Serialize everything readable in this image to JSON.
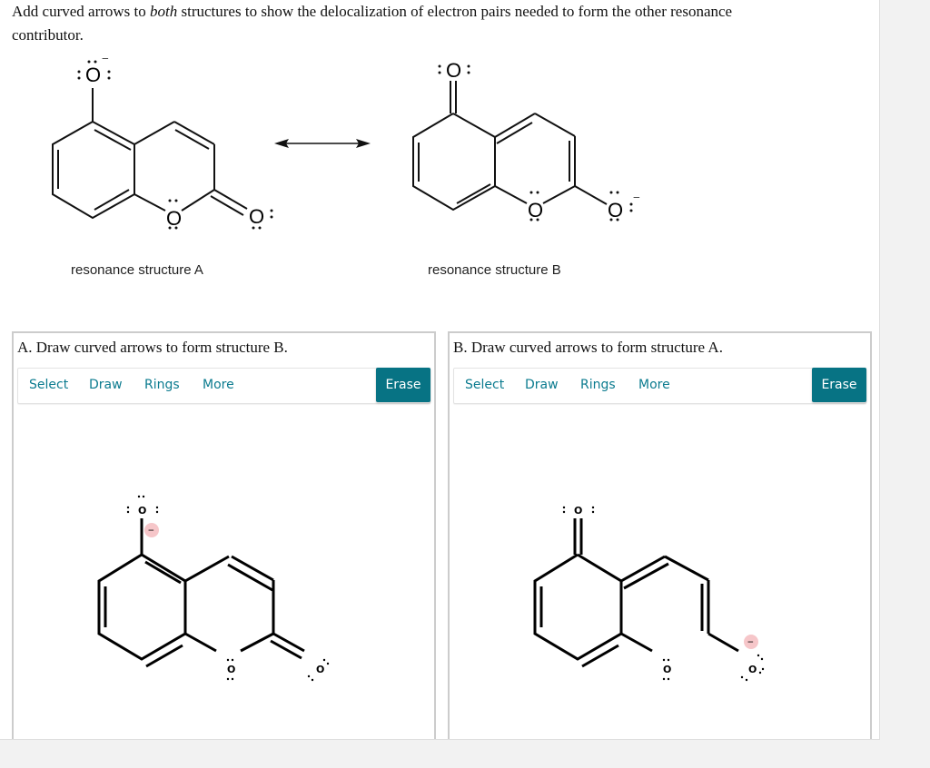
{
  "prompt": {
    "part1": "Add curved arrows to ",
    "emphasis": "both",
    "part2": " structures to show the delocalization of electron pairs needed to form the other resonance contributor."
  },
  "structures": {
    "a_caption": "resonance structure A",
    "b_caption": "resonance structure B",
    "atom_label": "O",
    "charge": "−",
    "resonance_arrow": "double-headed-arrow"
  },
  "panels": [
    {
      "title": "A. Draw curved arrows to form structure B.",
      "tools": [
        "Select",
        "Draw",
        "Rings",
        "More"
      ],
      "erase_label": "Erase"
    },
    {
      "title": "B. Draw curved arrows to form structure A.",
      "tools": [
        "Select",
        "Draw",
        "Rings",
        "More"
      ],
      "erase_label": "Erase"
    }
  ],
  "colors": {
    "accent": "#077384",
    "tool_text": "#0b7b8f",
    "charge_highlight": "#f6c6c9"
  }
}
